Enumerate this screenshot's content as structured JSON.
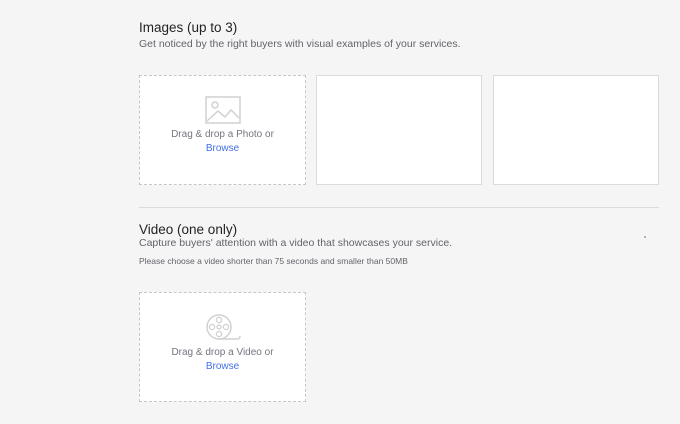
{
  "images": {
    "title": "Images (up to 3)",
    "description": "Get noticed by the right buyers with visual examples of your services.",
    "dropzone": {
      "icon": "image-icon",
      "text": "Drag & drop a Photo or",
      "browse": "Browse"
    }
  },
  "video": {
    "title": "Video (one only)",
    "description": "Capture buyers' attention with a video that showcases your service.",
    "note": "Please choose a video shorter than 75 seconds and smaller than 50MB",
    "dropzone": {
      "icon": "film-reel-icon",
      "text": "Drag & drop a Video or",
      "browse": "Browse"
    }
  },
  "colors": {
    "background": "#f5f5f5",
    "link": "#446ee7",
    "border": "#dadbdd"
  }
}
